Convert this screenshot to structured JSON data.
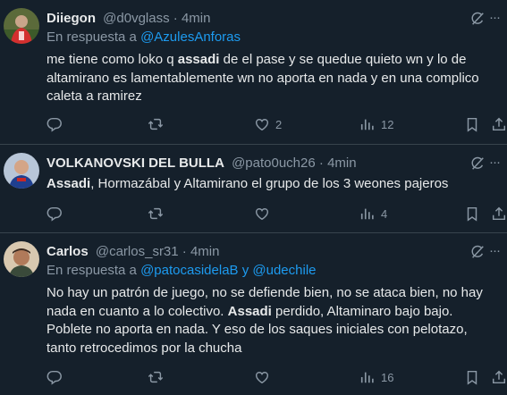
{
  "tweets": [
    {
      "name": "Diiegon",
      "handle": "@d0vglass",
      "dot": "·",
      "time": "4min",
      "reply_prefix": "En respuesta a",
      "reply_mention_1": "@AzulesAnforas",
      "body_1": "me tiene como loko q ",
      "body_bold": "assadi",
      "body_2": " de el pase y se quedue quieto wn y lo de altamirano es lamentablemente wn no aporta en nada y en una complico caleta a ramirez",
      "likes": "2",
      "views": "12",
      "more": "···"
    },
    {
      "name": "VOLKANOVSKI DEL BULLA",
      "handle": "@pato0uch26",
      "dot": "·",
      "time": "4min",
      "body_bold": "Assadi",
      "body_2": ", Hormazábal y Altamirano el grupo de los 3 weones pajeros",
      "views": "4",
      "more": "···"
    },
    {
      "name": "Carlos",
      "handle": "@carlos_sr31",
      "dot": "·",
      "time": "4min",
      "reply_prefix": "En respuesta a",
      "reply_mention_1": "@patocasidelaB",
      "reply_and": "y",
      "reply_mention_2": "@udechile",
      "body_1": "No hay un patrón de juego, no se defiende bien, no se ataca bien, no hay nada en cuanto a lo colectivo. ",
      "body_bold": "Assadi",
      "body_2": " perdido, Altaminaro bajo bajo. Poblete no aporta en nada. Y eso de los saques iniciales con pelotazo, tanto retrocedimos por la chucha",
      "views": "16",
      "more": "···"
    }
  ]
}
